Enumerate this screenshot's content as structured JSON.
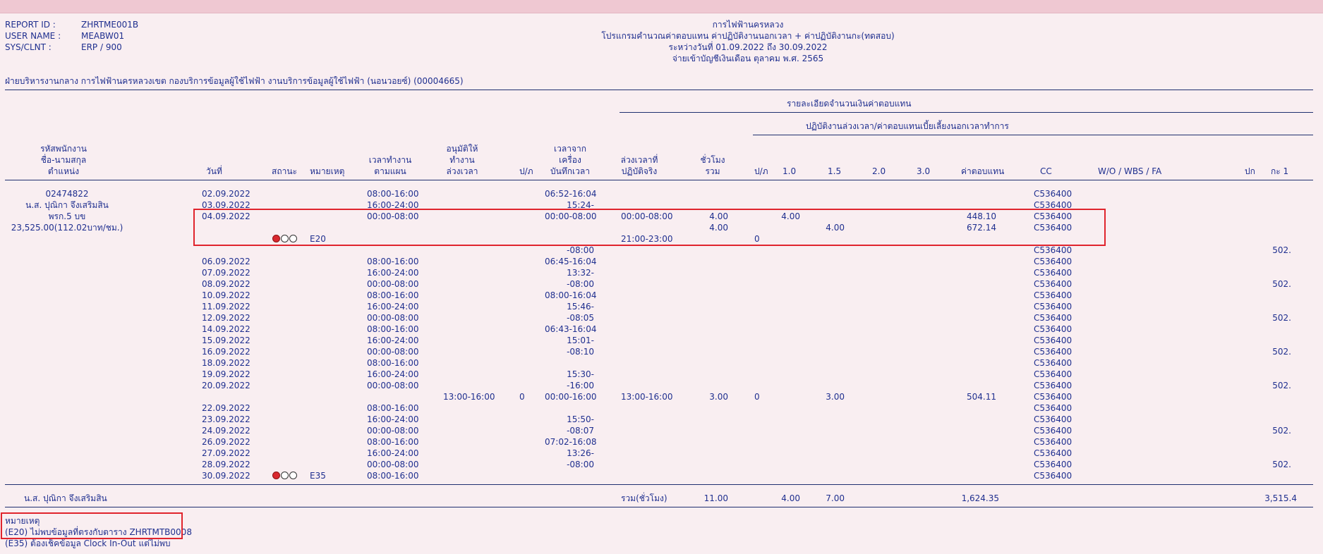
{
  "header": {
    "report_id_label": "REPORT ID :",
    "report_id_value": "ZHRTME001B",
    "user_name_label": "USER NAME :",
    "user_name_value": "MEABW01",
    "sys_label": "SYS/CLNT :",
    "sys_value": "ERP / 900",
    "title1": "การไฟฟ้านครหลวง",
    "title2": "โปรแกรมคำนวณค่าตอบแทน ค่าปฏิบัติงานนอกเวลา + ค่าปฏิบัติงานกะ(ทดสอบ)",
    "title3": "ระหว่างวันที่ 01.09.2022 ถึง 30.09.2022",
    "title4": "จ่ายเข้าบัญชีเงินเดือน ตุลาคม พ.ศ. 2565",
    "org_line": "ฝ่ายบริหารงานกลาง การไฟฟ้านครหลวงเขต กองบริการข้อมูลผู้ใช้ไฟฟ้า งานบริการข้อมูลผู้ใช้ไฟฟ้า (นอนวอยซ์) (00004665)"
  },
  "group_headers": {
    "compensation_detail": "รายละเอียดจำนวนเงินค่าตอบแทน",
    "overtime_group": "ปฏิบัติงานล่วงเวลา/ค่าตอบแทนเบี้ยเลี้ยงนอกเวลาทำการ"
  },
  "columns": {
    "emp_l1": "รหัสพนักงาน",
    "emp_l2": "ชื่อ-นามสกุล",
    "emp_l3": "ตำแหน่ง",
    "date": "วันที่",
    "status": "สถานะ",
    "remark": "หมายเหตุ",
    "plan_l1": "เวลาทำงาน",
    "plan_l2": "ตามแผน",
    "approve_l1": "อนุมัติให้",
    "approve_l2": "ทำงาน",
    "approve_l3": "ล่วงเวลา",
    "pa1": "ป/ภ",
    "machine_l1": "เวลาจาก",
    "machine_l2": "เครื่อง",
    "machine_l3": "บันทึกเวลา",
    "actual_l1": "ล่วงเวลาที่",
    "actual_l2": "ปฏิบัติจริง",
    "hours_l1": "ชั่วโมง",
    "hours_l2": "รวม",
    "pa2": "ป/ภ",
    "r10": "1.0",
    "r15": "1.5",
    "r20": "2.0",
    "r30": "3.0",
    "comp": "ค่าตอบแทน",
    "cc": "CC",
    "wo": "W/O / WBS / FA",
    "pk": "ปก",
    "ka1": "กะ 1"
  },
  "employee": {
    "id": "02474822",
    "name": "น.ส. ปุณิกา จึงเสริมสิน",
    "position": "พรก.5 บข",
    "salary": "23,525.00(112.02บาท/ชม.)"
  },
  "rows": [
    {
      "date": "02.09.2022",
      "plan": "08:00-16:00",
      "machine": "06:52-16:04",
      "cc": "C536400"
    },
    {
      "date": "03.09.2022",
      "plan": "16:00-24:00",
      "machine": "15:24-",
      "cc": "C536400"
    },
    {
      "date": "04.09.2022",
      "plan": "00:00-08:00",
      "machine": "00:00-08:00",
      "actual": "00:00-08:00",
      "hours": "4.00",
      "r10": "4.00",
      "comp": "448.10",
      "cc": "C536400"
    },
    {
      "hours": "4.00",
      "r15": "4.00",
      "comp": "672.14",
      "cc": "C536400"
    },
    {
      "status": "lamps",
      "remark": "E20",
      "actual": "21:00-23:00",
      "pa2": "0"
    },
    {
      "machine": "-08:00",
      "cc": "C536400",
      "ka1": "502."
    },
    {
      "date": "06.09.2022",
      "plan": "08:00-16:00",
      "machine": "06:45-16:04",
      "cc": "C536400"
    },
    {
      "date": "07.09.2022",
      "plan": "16:00-24:00",
      "machine": "13:32-",
      "cc": "C536400"
    },
    {
      "date": "08.09.2022",
      "plan": "00:00-08:00",
      "machine": "-08:00",
      "cc": "C536400",
      "ka1": "502."
    },
    {
      "date": "10.09.2022",
      "plan": "08:00-16:00",
      "machine": "08:00-16:04",
      "cc": "C536400"
    },
    {
      "date": "11.09.2022",
      "plan": "16:00-24:00",
      "machine": "15:46-",
      "cc": "C536400"
    },
    {
      "date": "12.09.2022",
      "plan": "00:00-08:00",
      "machine": "-08:05",
      "cc": "C536400",
      "ka1": "502."
    },
    {
      "date": "14.09.2022",
      "plan": "08:00-16:00",
      "machine": "06:43-16:04",
      "cc": "C536400"
    },
    {
      "date": "15.09.2022",
      "plan": "16:00-24:00",
      "machine": "15:01-",
      "cc": "C536400"
    },
    {
      "date": "16.09.2022",
      "plan": "00:00-08:00",
      "machine": "-08:10",
      "cc": "C536400",
      "ka1": "502."
    },
    {
      "date": "18.09.2022",
      "plan": "08:00-16:00",
      "cc": "C536400"
    },
    {
      "date": "19.09.2022",
      "plan": "16:00-24:00",
      "machine": "15:30-",
      "cc": "C536400"
    },
    {
      "date": "20.09.2022",
      "plan": "00:00-08:00",
      "machine": "-16:00",
      "cc": "C536400",
      "ka1": "502."
    },
    {
      "approve": "13:00-16:00",
      "pa1": "0",
      "machine": "00:00-16:00",
      "actual": "13:00-16:00",
      "hours": "3.00",
      "pa2": "0",
      "r15": "3.00",
      "comp": "504.11",
      "cc": "C536400"
    },
    {
      "date": "22.09.2022",
      "plan": "08:00-16:00",
      "cc": "C536400"
    },
    {
      "date": "23.09.2022",
      "plan": "16:00-24:00",
      "machine": "15:50-",
      "cc": "C536400"
    },
    {
      "date": "24.09.2022",
      "plan": "00:00-08:00",
      "machine": "-08:07",
      "cc": "C536400",
      "ka1": "502."
    },
    {
      "date": "26.09.2022",
      "plan": "08:00-16:00",
      "machine": "07:02-16:08",
      "cc": "C536400"
    },
    {
      "date": "27.09.2022",
      "plan": "16:00-24:00",
      "machine": "13:26-",
      "cc": "C536400"
    },
    {
      "date": "28.09.2022",
      "plan": "00:00-08:00",
      "machine": "-08:00",
      "cc": "C536400",
      "ka1": "502."
    },
    {
      "date": "30.09.2022",
      "status": "lamps",
      "remark": "E35",
      "plan": "08:00-16:00",
      "cc": "C536400"
    }
  ],
  "totals": {
    "name": "น.ส. ปุณิกา จึงเสริมสิน",
    "label": "รวม(ชั่วโมง)",
    "hours": "11.00",
    "r10": "4.00",
    "r15": "7.00",
    "comp": "1,624.35",
    "ka1": "3,515.4"
  },
  "footnotes": {
    "title": "หมายเหตุ",
    "e20": "(E20) ไม่พบข้อมูลที่ตรงกับตาราง ZHRTMTB0008",
    "e35": "(E35) ต้องเช็คข้อมูล Clock In-Out แต่ไม่พบ"
  },
  "colors": {
    "background": "#f9eef1",
    "topbar": "#efc8d2",
    "text": "#1f2f8f",
    "highlight_box": "#e0242d",
    "lamp_red": "#d9282f"
  }
}
